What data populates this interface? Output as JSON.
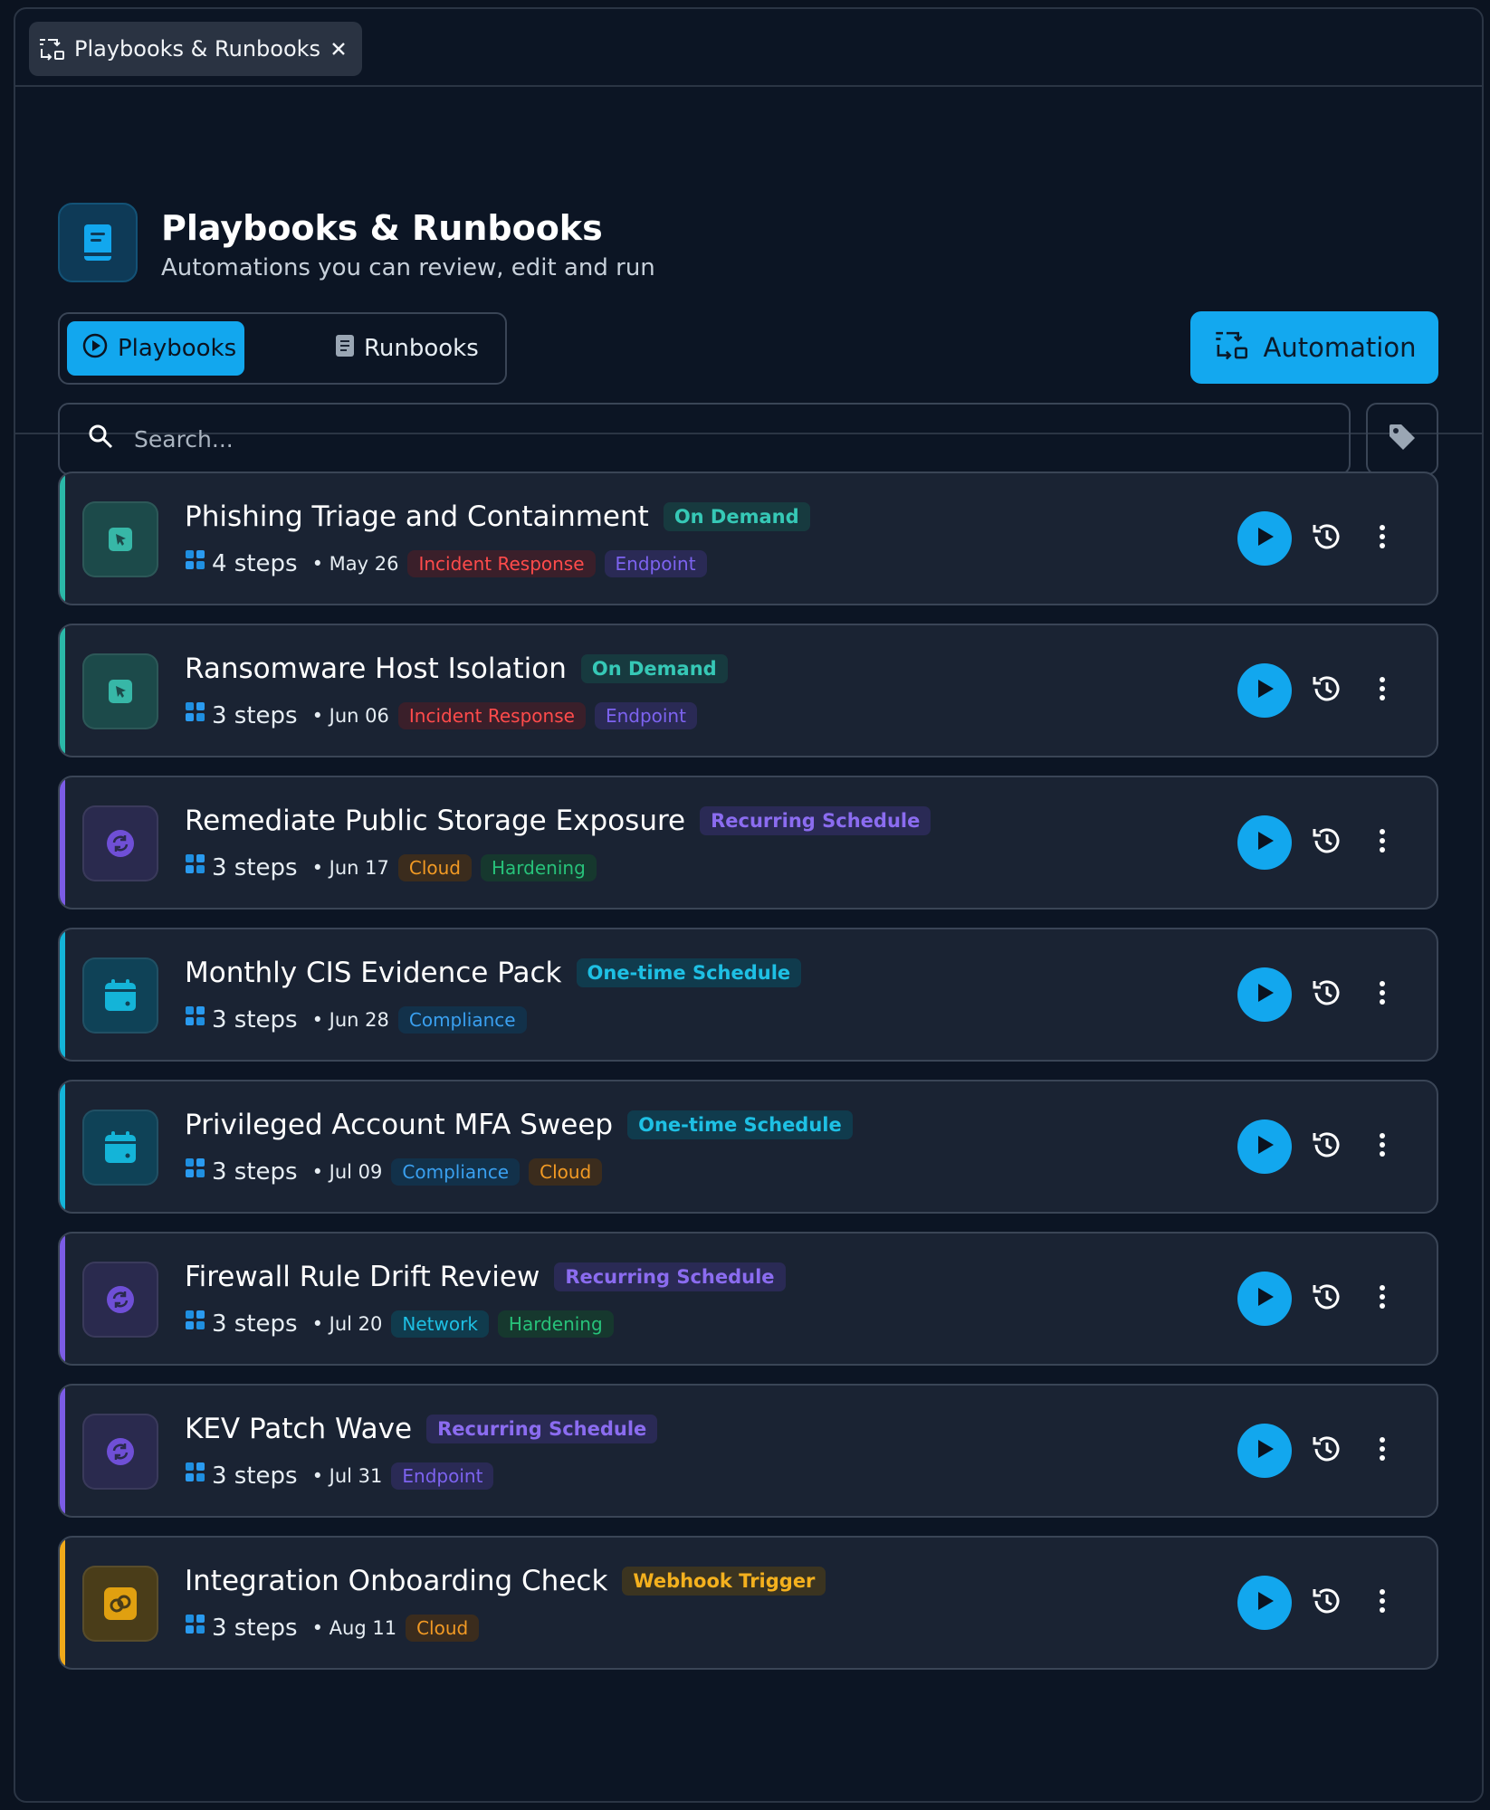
{
  "tab": {
    "label": "Playbooks & Runbooks",
    "icon": "automation-icon",
    "close_icon": "close-icon"
  },
  "header": {
    "title": "Playbooks & Runbooks",
    "subtitle": "Automations you can review, edit and run",
    "icon": "book-icon"
  },
  "segments": [
    {
      "label": "Playbooks",
      "icon": "play-circle-icon",
      "active": true
    },
    {
      "label": "Runbooks",
      "icon": "document-icon",
      "active": false
    }
  ],
  "automation_button": {
    "label": "Automation",
    "icon": "automation-icon"
  },
  "search": {
    "placeholder": "Search..."
  },
  "colors": {
    "accent": "#12a7ee",
    "on_demand": "#2bb8a8",
    "recurring": "#7c5ce6",
    "one_time": "#14b4d8",
    "webhook": "#f0a91a"
  },
  "playbooks": [
    {
      "title": "Phishing Triage and Containment",
      "trigger": "On Demand",
      "trigger_type": "on_demand",
      "icon": "cursor-icon",
      "steps": "4 steps",
      "date": "May 26",
      "tags": [
        {
          "label": "Incident Response",
          "kind": "incident"
        },
        {
          "label": "Endpoint",
          "kind": "endpoint"
        }
      ]
    },
    {
      "title": "Ransomware Host Isolation",
      "trigger": "On Demand",
      "trigger_type": "on_demand",
      "icon": "cursor-icon",
      "steps": "3 steps",
      "date": "Jun 06",
      "tags": [
        {
          "label": "Incident Response",
          "kind": "incident"
        },
        {
          "label": "Endpoint",
          "kind": "endpoint"
        }
      ]
    },
    {
      "title": "Remediate Public Storage Exposure",
      "trigger": "Recurring Schedule",
      "trigger_type": "recurring",
      "icon": "sync-icon",
      "steps": "3 steps",
      "date": "Jun 17",
      "tags": [
        {
          "label": "Cloud",
          "kind": "cloud"
        },
        {
          "label": "Hardening",
          "kind": "hardening"
        }
      ]
    },
    {
      "title": "Monthly CIS Evidence Pack",
      "trigger": "One-time Schedule",
      "trigger_type": "one_time",
      "icon": "calendar-icon",
      "steps": "3 steps",
      "date": "Jun 28",
      "tags": [
        {
          "label": "Compliance",
          "kind": "compliance"
        }
      ]
    },
    {
      "title": "Privileged Account MFA Sweep",
      "trigger": "One-time Schedule",
      "trigger_type": "one_time",
      "icon": "calendar-icon",
      "steps": "3 steps",
      "date": "Jul 09",
      "tags": [
        {
          "label": "Compliance",
          "kind": "compliance"
        },
        {
          "label": "Cloud",
          "kind": "cloud"
        }
      ]
    },
    {
      "title": "Firewall Rule Drift Review",
      "trigger": "Recurring Schedule",
      "trigger_type": "recurring",
      "icon": "sync-icon",
      "steps": "3 steps",
      "date": "Jul 20",
      "tags": [
        {
          "label": "Network",
          "kind": "network"
        },
        {
          "label": "Hardening",
          "kind": "hardening"
        }
      ]
    },
    {
      "title": "KEV Patch Wave",
      "trigger": "Recurring Schedule",
      "trigger_type": "recurring",
      "icon": "sync-icon",
      "steps": "3 steps",
      "date": "Jul 31",
      "tags": [
        {
          "label": "Endpoint",
          "kind": "endpoint"
        }
      ]
    },
    {
      "title": "Integration Onboarding Check",
      "trigger": "Webhook Trigger",
      "trigger_type": "webhook",
      "icon": "link-icon",
      "steps": "3 steps",
      "date": "Aug 11",
      "tags": [
        {
          "label": "Cloud",
          "kind": "cloud"
        }
      ]
    }
  ]
}
